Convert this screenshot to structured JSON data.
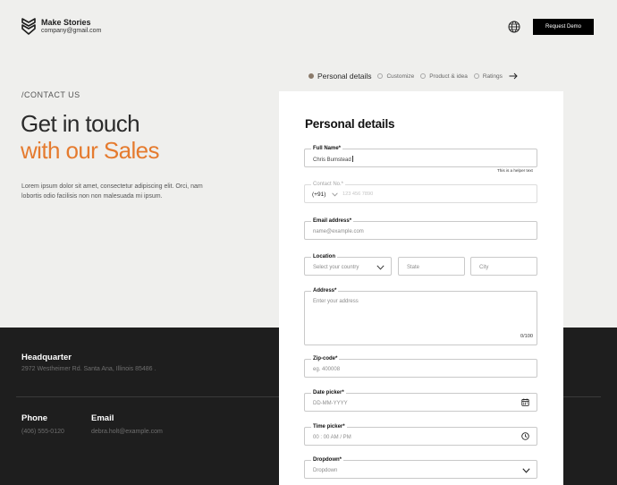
{
  "brand": {
    "name": "Make Stories",
    "email": "company@gmail.com"
  },
  "header": {
    "request_demo_label": "Request Demo"
  },
  "stepper": {
    "steps": [
      {
        "label": "Personal details",
        "active": true
      },
      {
        "label": "Customize",
        "active": false
      },
      {
        "label": "Product & idea",
        "active": false
      },
      {
        "label": "Ratings",
        "active": false
      }
    ]
  },
  "hero": {
    "eyebrow": "/CONTACT US",
    "headline_line1": "Get in touch",
    "headline_line2": "with our Sales",
    "lede": "Lorem ipsum dolor sit amet, consectetur adipiscing elit. Orci, nam lobortis odio facilisis non non malesuada mi ipsum.",
    "accent_color": "#e57b2f"
  },
  "footer": {
    "headquarter_title": "Headquarter",
    "headquarter_address": "2972 Westheimer Rd. Santa Ana, Illinois 85486 .",
    "phone_title": "Phone",
    "phone_value": "(406) 555-0120",
    "email_title": "Email",
    "email_value": "debra.holt@example.com"
  },
  "form": {
    "title": "Personal details",
    "full_name": {
      "label": "Full Name*",
      "value": "Chris Bumstead",
      "helper": "This is a helper text"
    },
    "contact": {
      "label": "Contact No.*",
      "code": "(+91)",
      "placeholder": "123 456 7890"
    },
    "email": {
      "label": "Email address*",
      "placeholder": "name@example.com"
    },
    "location": {
      "label": "Location",
      "country_placeholder": "Select your country",
      "state_placeholder": "State",
      "city_placeholder": "City"
    },
    "address": {
      "label": "Address*",
      "placeholder": "Enter your address",
      "counter": "0/100"
    },
    "zip": {
      "label": "Zip-code*",
      "placeholder": "eg. 400008"
    },
    "date": {
      "label": "Date picker*",
      "placeholder": "DD-MM-YYYY"
    },
    "time": {
      "label": "Time picker*",
      "placeholder": "00 : 00 AM / PM"
    },
    "dropdown": {
      "label": "Dropdown*",
      "placeholder": "Dropdown"
    }
  }
}
